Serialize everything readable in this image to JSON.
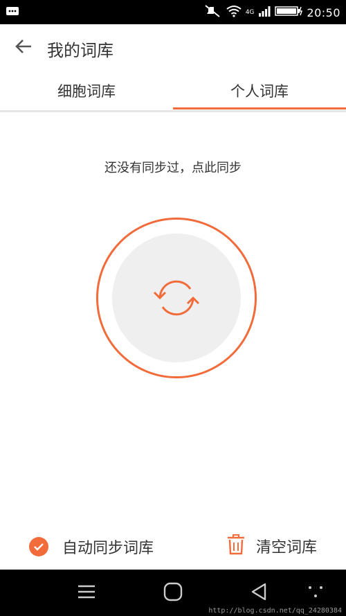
{
  "status_bar": {
    "time": "20:50",
    "network": "4G"
  },
  "header": {
    "title": "我的词库"
  },
  "tabs": [
    {
      "label": "细胞词库",
      "selected": false
    },
    {
      "label": "个人词库",
      "selected": true
    }
  ],
  "main": {
    "hint": "还没有同步过，点此同步"
  },
  "footer": {
    "auto_sync_label": "自动同步词库",
    "auto_sync_checked": true,
    "clear_label": "清空词库"
  },
  "watermark": "http://blog.csdn.net/qq_24280384",
  "colors": {
    "accent": "#f26b3a",
    "circle_fill": "#efefef",
    "text": "#333333"
  },
  "icons": [
    "back-arrow-icon",
    "sync-icon",
    "check-icon",
    "trash-icon",
    "menu-icon",
    "home-icon",
    "back-nav-icon",
    "dots-icon"
  ]
}
